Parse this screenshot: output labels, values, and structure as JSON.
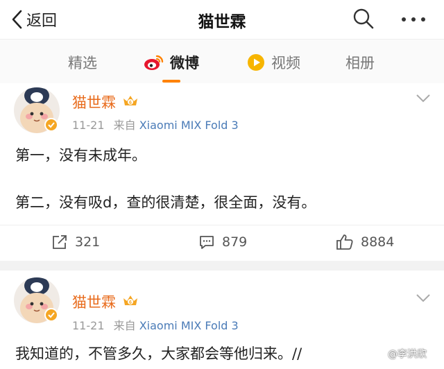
{
  "header": {
    "back_label": "返回",
    "title": "猫世霖"
  },
  "tabs": [
    {
      "label": "精选"
    },
    {
      "label": "微博"
    },
    {
      "label": "视频"
    },
    {
      "label": "相册"
    }
  ],
  "posts": [
    {
      "author": "猫世霖",
      "vip_level": "6",
      "date": "11-21",
      "source_prefix": "来自",
      "source": "Xiaomi MIX Fold 3",
      "lines": [
        "第一，没有未成年。",
        "第二，没有吸d，查的很清楚，很全面，没有。"
      ],
      "reposts": "321",
      "comments": "879",
      "likes": "8884"
    },
    {
      "author": "猫世霖",
      "vip_level": "6",
      "date": "11-21",
      "source_prefix": "来自",
      "source": "Xiaomi MIX Fold 3",
      "lines": [
        "我知道的，不管多久，大家都会等他归来。//"
      ]
    }
  ],
  "watermark": "@李洪欣",
  "colors": {
    "accent": "#ff8200",
    "username": "#e86b1c",
    "source_link": "#4a7bb7",
    "separator": "#f2f2f2"
  }
}
